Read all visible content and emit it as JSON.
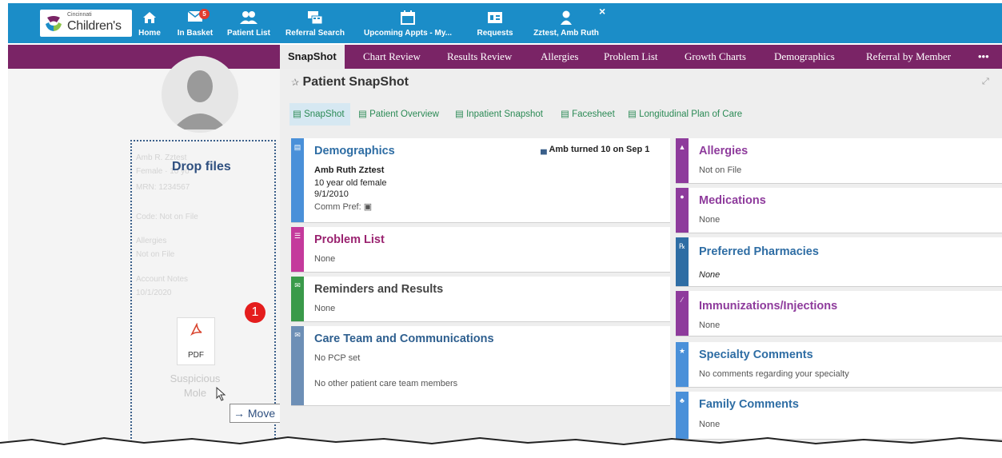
{
  "topnav": {
    "logo_small": "Cincinnati",
    "logo_big": "Children's",
    "items": [
      {
        "label": "Home",
        "icon": "home-icon"
      },
      {
        "label": "In Basket",
        "icon": "mail-icon",
        "badge": "5"
      },
      {
        "label": "Patient List",
        "icon": "users-icon"
      },
      {
        "label": "Referral Search",
        "icon": "referral-icon"
      },
      {
        "label": "Upcoming Appts - My...",
        "icon": "calendar-icon"
      },
      {
        "label": "Requests",
        "icon": "requests-icon"
      },
      {
        "label": "Zztest, Amb Ruth",
        "icon": "person-icon"
      }
    ],
    "close": "×"
  },
  "tabs": [
    "SnapShot",
    "Chart Review",
    "Results Review",
    "Allergies",
    "Problem List",
    "Growth Charts",
    "Demographics",
    "Referral by Member",
    "•••"
  ],
  "leftpanel": {
    "drop_label": "Drop files",
    "ghost_lines": [
      "Amb R. Zztest",
      "Female · 10 yo",
      "MRN: 1234567",
      "Code: Not on File",
      "Allergies",
      "Not on File",
      "Account Notes",
      "10/1/2020"
    ],
    "pdf_label": "PDF",
    "file_name_1": "Suspicious",
    "file_name_2": "Mole",
    "move_label": "→ Move",
    "step_number": "1"
  },
  "main": {
    "title": "Patient SnapShot",
    "subtabs": [
      "SnapShot",
      "Patient Overview",
      "Inpatient Snapshot",
      "Facesheet",
      "Longitudinal Plan of Care"
    ],
    "left_cards": [
      {
        "title": "Demographics",
        "color": "#4a90d9",
        "title_color": "#2e6da4",
        "badge": "Amb turned 10 on Sep 1",
        "lines": [
          "Amb Ruth Zztest",
          "10 year old female",
          "9/1/2010",
          "Comm Pref:"
        ]
      },
      {
        "title": "Problem List",
        "color": "#c43a9c",
        "title_color": "#9a2370",
        "lines": [
          "None"
        ]
      },
      {
        "title": "Reminders and Results",
        "color": "#3a9a4a",
        "title_color": "#444444",
        "lines": [
          "None"
        ]
      },
      {
        "title": "Care Team and Communications",
        "color": "#6d8fb6",
        "title_color": "#2e5f8f",
        "lines": [
          "No PCP set",
          "No other patient care team members"
        ]
      }
    ],
    "right_cards": [
      {
        "title": "Allergies",
        "color": "#8e3b9c",
        "title_color": "#8e3b9c",
        "lines": [
          "Not on File"
        ]
      },
      {
        "title": "Medications",
        "color": "#8e3b9c",
        "title_color": "#8e3b9c",
        "lines": [
          "None"
        ]
      },
      {
        "title": "Preferred Pharmacies",
        "color": "#2e6da4",
        "title_color": "#2e6da4",
        "lines": [
          "None"
        ]
      },
      {
        "title": "Immunizations/Injections",
        "color": "#8e3b9c",
        "title_color": "#8e3b9c",
        "lines": [
          "None"
        ]
      },
      {
        "title": "Specialty Comments",
        "color": "#4a90d9",
        "title_color": "#2e6da4",
        "lines": [
          "No comments regarding your specialty"
        ]
      },
      {
        "title": "Family Comments",
        "color": "#4a90d9",
        "title_color": "#2e6da4",
        "lines": [
          "None"
        ]
      }
    ]
  }
}
